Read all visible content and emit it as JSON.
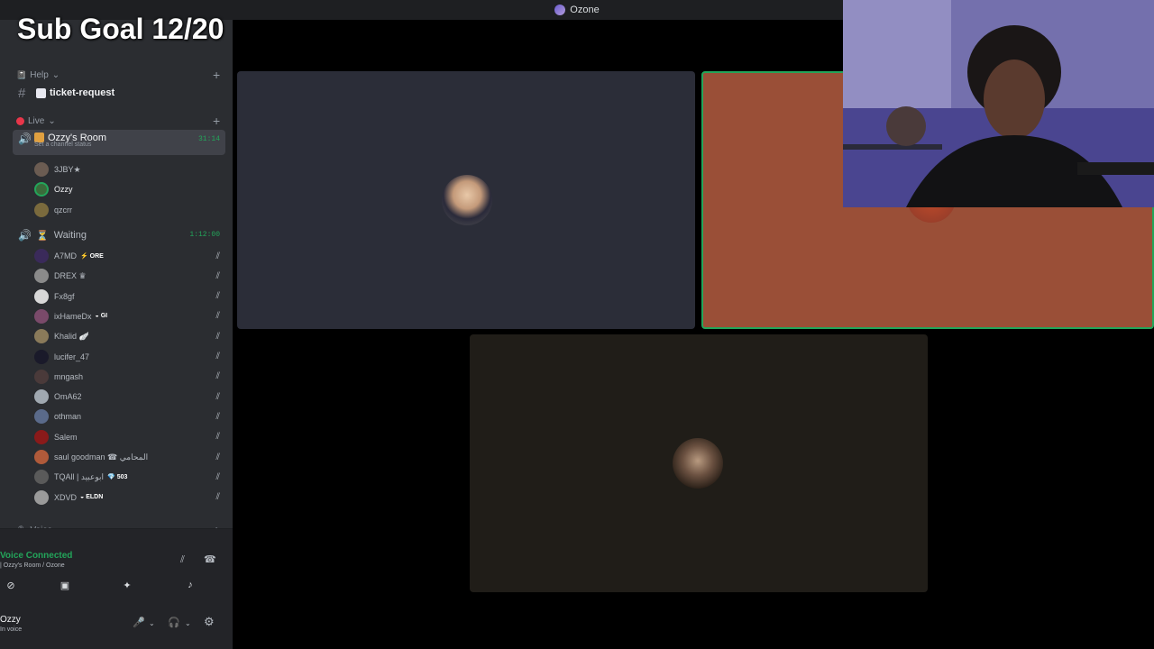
{
  "window": {
    "title": "Ozone"
  },
  "overlay": {
    "subgoal": "Sub Goal 12/20"
  },
  "categories": {
    "help": "Help",
    "live": "Live",
    "voice": "Voice"
  },
  "channels": {
    "ticket": "ticket-request",
    "room": {
      "name": "Ozzy's Room",
      "status": "Set a channel status",
      "timer": "31:14"
    },
    "waiting": {
      "name": "Waiting",
      "timer": "1:12:00"
    }
  },
  "room_members": [
    {
      "name": "3JBY★",
      "avatar_color": "#6b5c52"
    },
    {
      "name": "Ozzy",
      "avatar_color": "#3b6b3b"
    },
    {
      "name": "qzcrr",
      "avatar_color": "#7a6a3d"
    }
  ],
  "waiting_members": [
    {
      "name": "A7MD",
      "tag": "⚡ ORE",
      "avatar_color": "#3a2a5a"
    },
    {
      "name": "DREX ♛",
      "tag": "",
      "avatar_color": "#8a8a8a"
    },
    {
      "name": "Fx8gf",
      "tag": "",
      "avatar_color": "#d8d8d8"
    },
    {
      "name": "ixHameDx",
      "tag": "◒ GI",
      "avatar_color": "#7a4a6a"
    },
    {
      "name": "Khalid 🪽",
      "tag": "",
      "avatar_color": "#8a7a5a"
    },
    {
      "name": "lucifer_47",
      "tag": "",
      "avatar_color": "#1a1a2a"
    },
    {
      "name": "mngash",
      "tag": "",
      "avatar_color": "#4a3a3a"
    },
    {
      "name": "OmA62",
      "tag": "",
      "avatar_color": "#a0a8b0"
    },
    {
      "name": "othman",
      "tag": "",
      "avatar_color": "#5a6a8a"
    },
    {
      "name": "Salem",
      "tag": "",
      "avatar_color": "#8a1a1a"
    },
    {
      "name": "saul goodman ☎ المحامي",
      "tag": "",
      "avatar_color": "#b05a3a"
    },
    {
      "name": "TQAll | ابوعبيد",
      "tag": "💎 503",
      "avatar_color": "#5a5a5a"
    },
    {
      "name": "XDVD",
      "tag": "◒ ELDN",
      "avatar_color": "#9a9a9a"
    }
  ],
  "voice_panel": {
    "title": "Voice Connected",
    "subtitle": "| Ozzy's Room / Ozone"
  },
  "user_panel": {
    "name": "Ozzy",
    "status": "In voice"
  },
  "colors": {
    "online": "#23a55a",
    "tile_speaking_border": "#23a55a",
    "tile_orange": "#9a4f37"
  },
  "icons": {
    "mute": "mic-off-icon",
    "speaker": "speaker-icon",
    "settings": "gear-icon"
  }
}
